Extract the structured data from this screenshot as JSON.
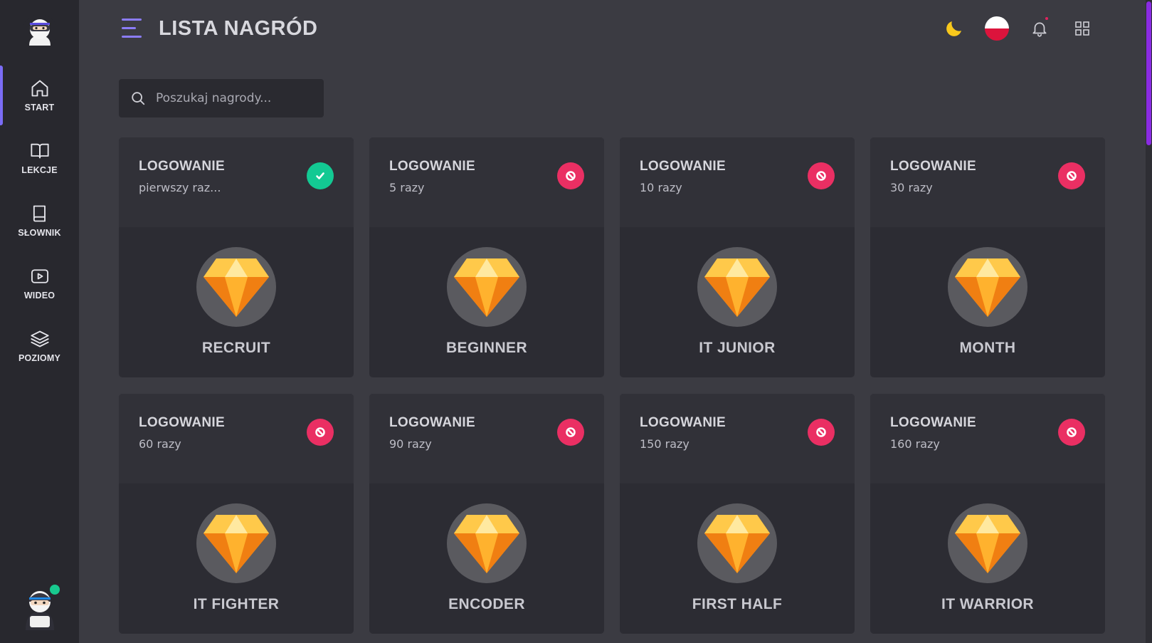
{
  "sidebar": {
    "items": [
      {
        "label": "START",
        "icon": "home-icon",
        "active": true
      },
      {
        "label": "LEKCJE",
        "icon": "book-open-icon",
        "active": false
      },
      {
        "label": "SŁOWNIK",
        "icon": "book-icon",
        "active": false
      },
      {
        "label": "WIDEO",
        "icon": "video-icon",
        "active": false
      },
      {
        "label": "POZIOMY",
        "icon": "layers-icon",
        "active": false
      }
    ]
  },
  "header": {
    "title": "LISTA NAGRÓD"
  },
  "search": {
    "placeholder": "Poszukaj nagrody..."
  },
  "rewards": [
    {
      "category": "LOGOWANIE",
      "detail": "pierwszy raz...",
      "name": "RECRUIT",
      "status": "done"
    },
    {
      "category": "LOGOWANIE",
      "detail": "5 razy",
      "name": "BEGINNER",
      "status": "locked"
    },
    {
      "category": "LOGOWANIE",
      "detail": "10 razy",
      "name": "IT JUNIOR",
      "status": "locked"
    },
    {
      "category": "LOGOWANIE",
      "detail": "30 razy",
      "name": "MONTH",
      "status": "locked"
    },
    {
      "category": "LOGOWANIE",
      "detail": "60 razy",
      "name": "IT FIGHTER",
      "status": "locked"
    },
    {
      "category": "LOGOWANIE",
      "detail": "90 razy",
      "name": "ENCODER",
      "status": "locked"
    },
    {
      "category": "LOGOWANIE",
      "detail": "150 razy",
      "name": "FIRST HALF",
      "status": "locked"
    },
    {
      "category": "LOGOWANIE",
      "detail": "160 razy",
      "name": "IT WARRIOR",
      "status": "locked"
    }
  ],
  "colors": {
    "accent": "#7b6cf6",
    "done": "#13c993",
    "locked": "#ea2f63",
    "gem": "#ffa81c"
  }
}
